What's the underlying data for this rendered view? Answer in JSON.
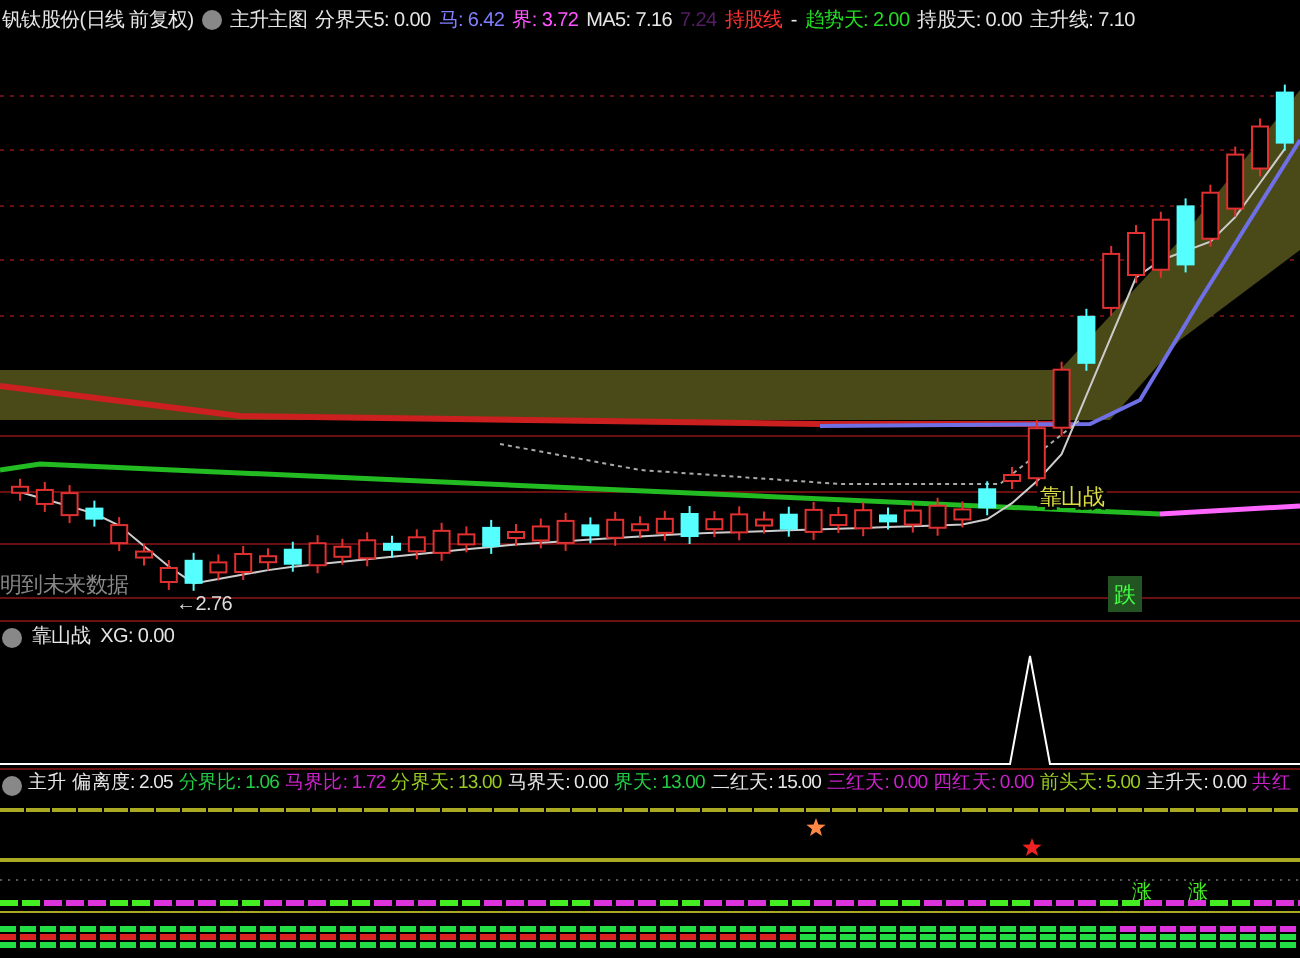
{
  "header": {
    "stock": "钒钛股份(日线 前复权)",
    "indicator": "主升主图",
    "items": [
      {
        "text": "分界天5: 0.00",
        "color": "#e6e6e6"
      },
      {
        "text": "马: 6.42",
        "color": "#7f7fff"
      },
      {
        "text": "界: 3.72",
        "color": "#ff55ff"
      },
      {
        "text": "MA5: 7.16",
        "color": "#e6e6e6"
      },
      {
        "text": "7.24",
        "color": "#551d66"
      },
      {
        "text": "持股线",
        "color": "#ff3030"
      },
      {
        "text": "-",
        "color": "#e6e6e6"
      },
      {
        "text": "趋势天: 2.00",
        "color": "#22dd22"
      },
      {
        "text": "持股天: 0.00",
        "color": "#e6e6e6"
      },
      {
        "text": "主升线: 7.10",
        "color": "#e6e6e6"
      }
    ]
  },
  "main_chart": {
    "note": "明到未来数据",
    "low_label": "←2.76",
    "signal_label": "靠山战",
    "badge": "跌"
  },
  "sub_panel": {
    "title": "靠山战",
    "reading": "XG: 0.00"
  },
  "indicator_panel": {
    "title": "主升",
    "items": [
      {
        "text": "偏离度: 2.05",
        "color": "#e6e6e6"
      },
      {
        "text": "分界比: 1.06",
        "color": "#22cc44"
      },
      {
        "text": "马界比: 1.72",
        "color": "#cc22cc"
      },
      {
        "text": "分界天: 13.00",
        "color": "#99cc22"
      },
      {
        "text": "马界天: 0.00",
        "color": "#e6e6e6"
      },
      {
        "text": "界天: 13.00",
        "color": "#22cc44"
      },
      {
        "text": "二红天: 15.00",
        "color": "#e6e6e6"
      },
      {
        "text": "三红天: 0.00",
        "color": "#cc22cc"
      },
      {
        "text": "四红天: 0.00",
        "color": "#cc22cc"
      },
      {
        "text": "前头天: 5.00",
        "color": "#99cc22"
      },
      {
        "text": "主升天: 0.00",
        "color": "#e6e6e6"
      },
      {
        "text": "共红",
        "color": "#cc22cc"
      }
    ],
    "markers": [
      "涨",
      "涨"
    ]
  }
}
